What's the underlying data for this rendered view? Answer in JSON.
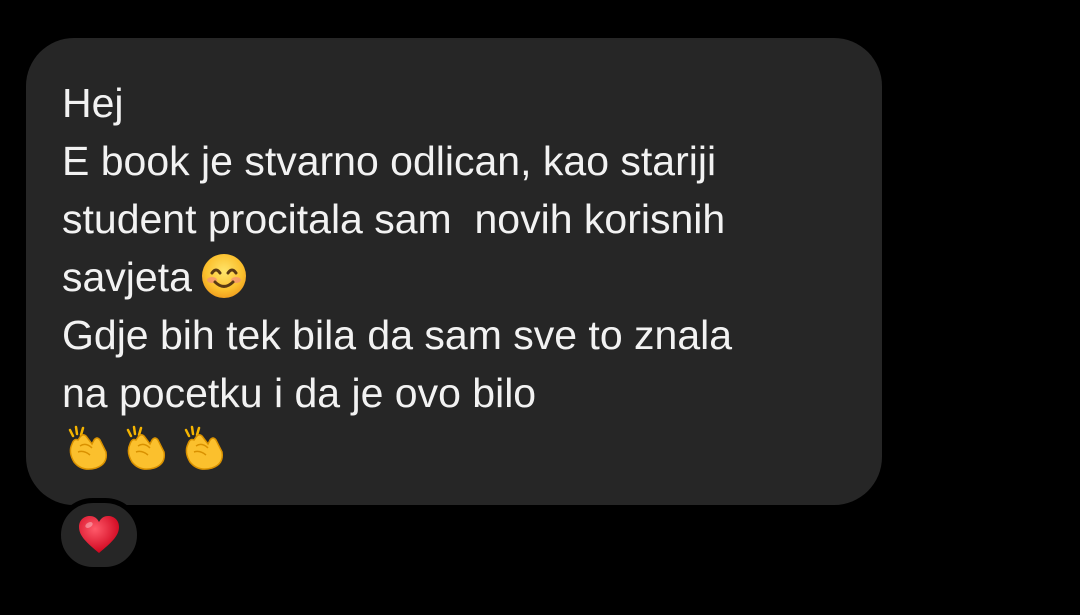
{
  "message": {
    "lines": [
      "Hej",
      "E book je stvarno odlican, kao stariji",
      "student procitala sam  novih korisnih",
      "savjeta",
      "Gdje bih tek bila da sam sve to znala",
      "na pocetku i da je ovo bilo"
    ],
    "inline_emoji": "smiling-face-with-smiling-eyes",
    "trailing_emojis": [
      "clapping-hands",
      "clapping-hands",
      "clapping-hands"
    ]
  },
  "reaction": {
    "emoji": "red-heart"
  },
  "colors": {
    "background": "#000000",
    "bubble": "#262626",
    "text": "#f2f2f2",
    "heart": "#e0102a",
    "emoji_yellow": "#fbc02d"
  }
}
